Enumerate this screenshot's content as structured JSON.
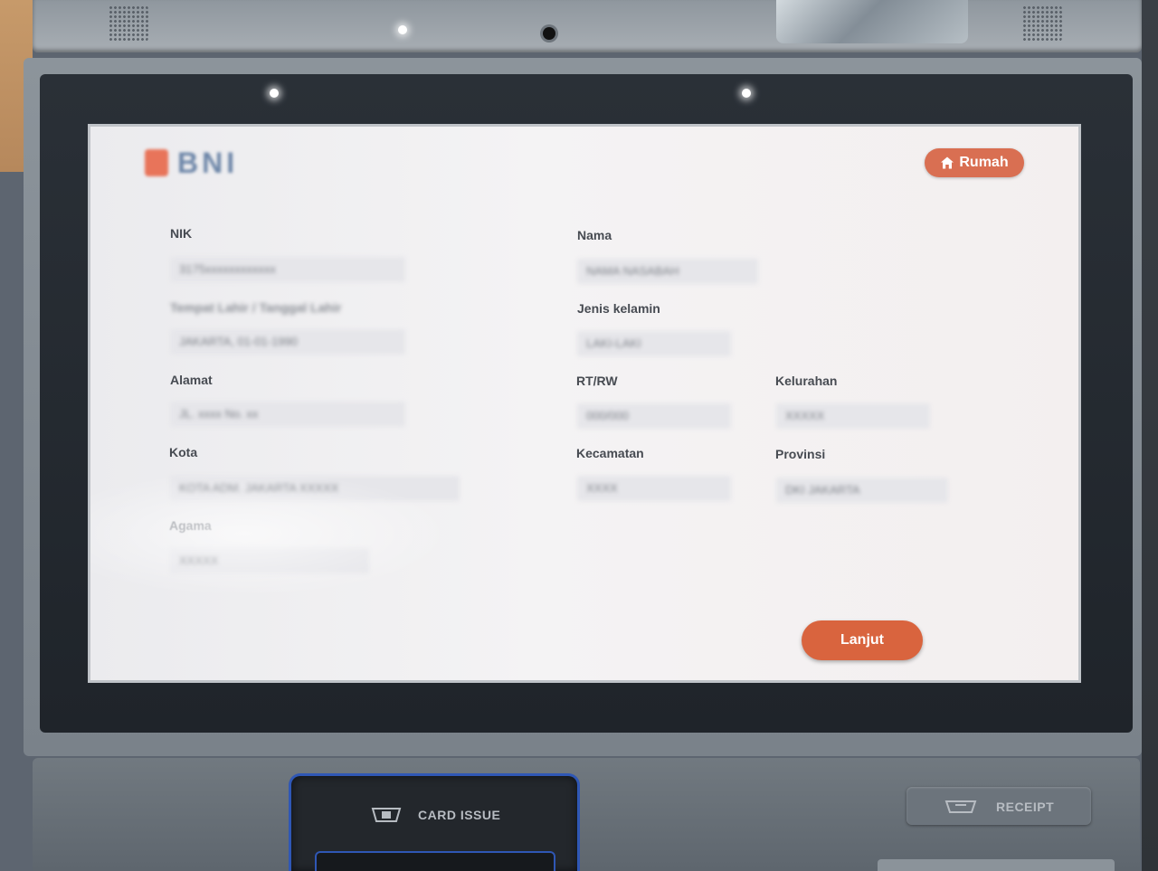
{
  "brand": {
    "logo_text": "BNI"
  },
  "header": {
    "home_label": "Rumah"
  },
  "form": {
    "nik": {
      "label": "NIK",
      "value": "3175xxxxxxxxxxxx"
    },
    "birth": {
      "label": "Tempat Lahir / Tanggal Lahir",
      "value": "JAKARTA, 01-01-1990"
    },
    "nama": {
      "label": "Nama",
      "value": "NAMA NASABAH"
    },
    "jenis_kelamin": {
      "label": "Jenis kelamin",
      "value": "LAKI-LAKI"
    },
    "alamat": {
      "label": "Alamat",
      "value": "JL. xxxx No. xx"
    },
    "rt_rw": {
      "label": "RT/RW",
      "value": "000/000"
    },
    "kelurahan": {
      "label": "Kelurahan",
      "value": "XXXXX"
    },
    "kota": {
      "label": "Kota",
      "value": "KOTA ADM. JAKARTA XXXXX"
    },
    "kecamatan": {
      "label": "Kecamatan",
      "value": "XXXX"
    },
    "provinsi": {
      "label": "Provinsi",
      "value": "DKI JAKARTA"
    },
    "agama": {
      "label": "Agama",
      "value": "XXXXX"
    }
  },
  "actions": {
    "next_label": "Lanjut"
  },
  "hardware": {
    "card_issue_label": "CARD ISSUE",
    "receipt_label": "RECEIPT"
  },
  "colors": {
    "accent": "#d9643e",
    "home_button": "#d96f52",
    "card_slot_border": "#2f57b5"
  },
  "icons": {
    "home": "house-icon",
    "card": "card-tray-icon",
    "receipt": "receipt-tray-icon"
  }
}
